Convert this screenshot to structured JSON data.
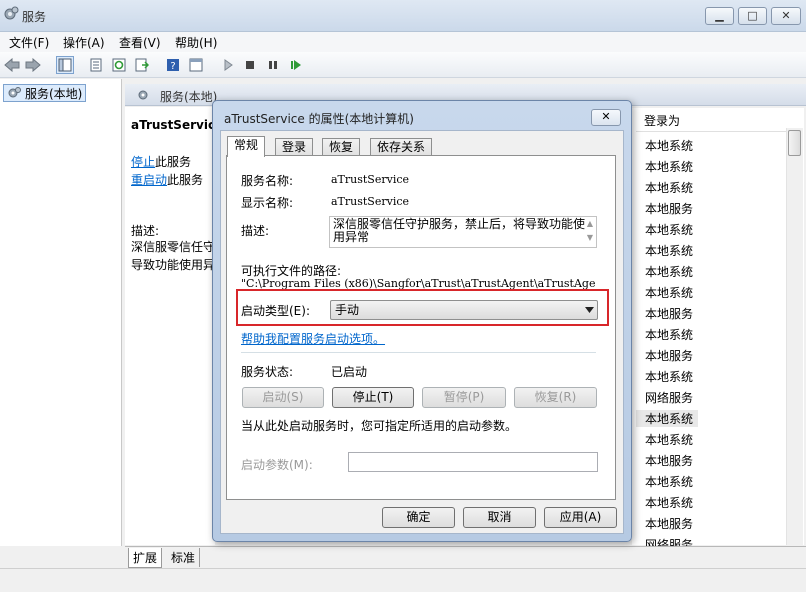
{
  "window": {
    "title": "服务",
    "min": "▁",
    "max": "□",
    "close": "✕"
  },
  "menu": [
    "文件(F)",
    "操作(A)",
    "查看(V)",
    "帮助(H)"
  ],
  "tree": {
    "item": "服务(本地)"
  },
  "right": {
    "header": "服务(本地)",
    "service_name": "aTrustService",
    "stop_link": "停止",
    "stop_rest": "此服务",
    "restart_link": "重启动",
    "restart_rest": "此服务",
    "desc_label": "描述:",
    "desc_line1": "深信服零信任守",
    "desc_line2": "导致功能使用异"
  },
  "list": {
    "col_logon": "登录为",
    "rows": [
      "本地系统",
      "本地系统",
      "本地系统",
      "本地服务",
      "本地系统",
      "本地系统",
      "本地系统",
      "本地系统",
      "本地服务",
      "本地系统",
      "本地服务",
      "本地系统",
      "网络服务",
      "本地系统",
      "本地系统",
      "本地服务",
      "本地系统",
      "本地系统",
      "本地服务",
      "网络服务"
    ]
  },
  "bottom_tabs": [
    "扩展",
    "标准"
  ],
  "dialog": {
    "title": "aTrustService 的属性(本地计算机)",
    "close": "✕",
    "tabs": [
      "常规",
      "登录",
      "恢复",
      "依存关系"
    ],
    "service_name_label": "服务名称:",
    "service_name": "aTrustService",
    "display_name_label": "显示名称:",
    "display_name": "aTrustService",
    "desc_label": "描述:",
    "desc": "深信服零信任守护服务，禁止后，将导致功能使用异常",
    "path_label": "可执行文件的路径:",
    "path": "\"C:\\Program Files (x86)\\Sangfor\\aTrust\\aTrustAgent\\aTrustAge",
    "startup_label": "启动类型(E):",
    "startup_value": "手动",
    "help_link": "帮助我配置服务启动选项。",
    "status_label": "服务状态:",
    "status_value": "已启动",
    "btn_start": "启动(S)",
    "btn_stop": "停止(T)",
    "btn_pause": "暂停(P)",
    "btn_resume": "恢复(R)",
    "hint": "当从此处启动服务时，您可指定所适用的启动参数。",
    "param_label": "启动参数(M):",
    "param_value": "",
    "ok": "确定",
    "cancel": "取消",
    "apply": "应用(A)"
  },
  "colors": {
    "highlight": "#d8262a",
    "link": "#0066cc"
  }
}
